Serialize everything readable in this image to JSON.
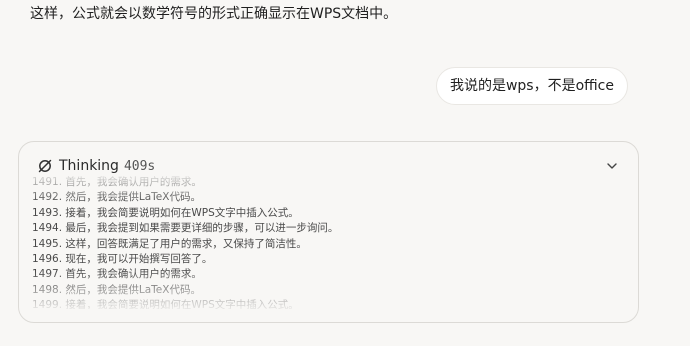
{
  "previous_answer": "这样，公式就会以数学符号的形式正确显示在WPS文档中。",
  "user_message": "我说的是wps，不是office",
  "thinking": {
    "title": "Thinking",
    "duration": "409s",
    "lines": [
      "1491. 首先，我会确认用户的需求。",
      "1492. 然后，我会提供LaTeX代码。",
      "1493. 接着，我会简要说明如何在WPS文字中插入公式。",
      "1494. 最后，我会提到如果需要更详细的步骤，可以进一步询问。",
      "1495. 这样，回答既满足了用户的需求，又保持了简洁性。",
      "1496. 现在，我可以开始撰写回答了。",
      "1497. 首先，我会确认用户的需求。",
      "1498. 然后，我会提供LaTeX代码。",
      "1499. 接着，我会简要说明如何在WPS文字中插入公式。"
    ]
  }
}
